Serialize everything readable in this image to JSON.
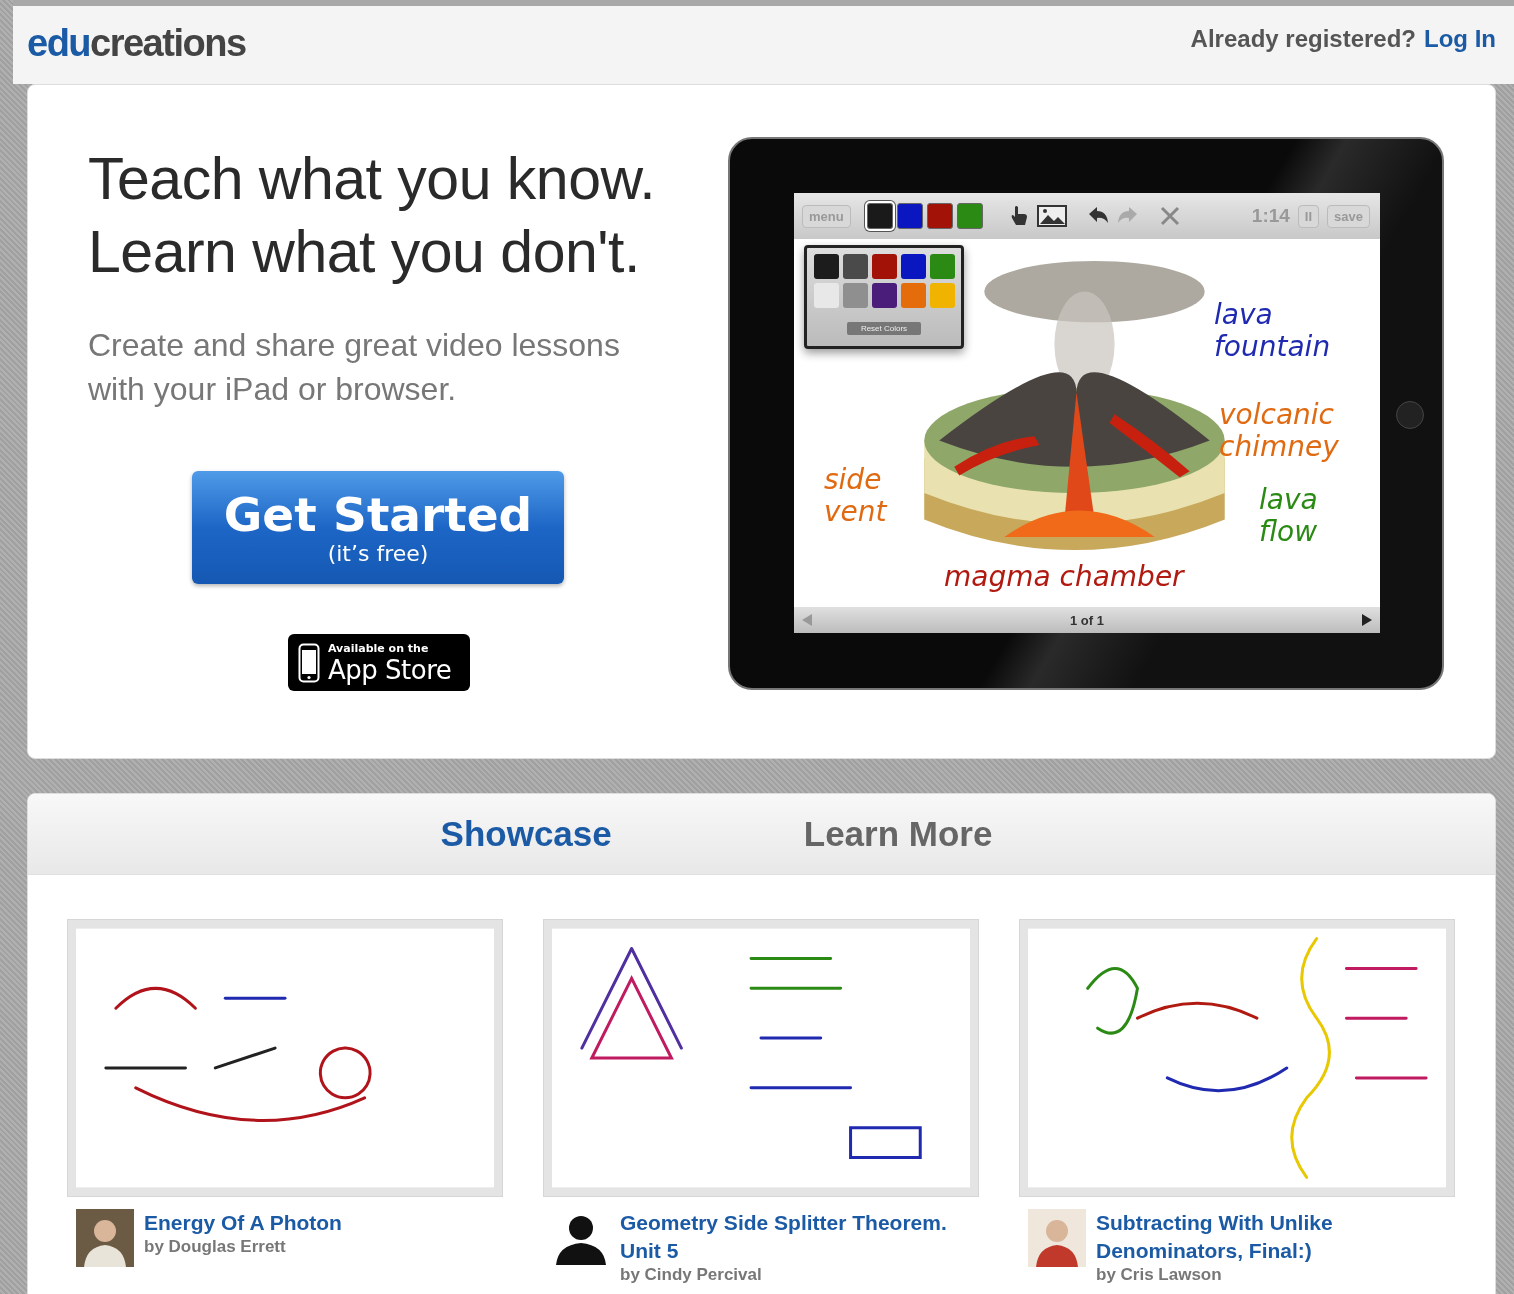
{
  "header": {
    "logo": {
      "part1": "edu",
      "part2": "creations"
    },
    "prompt": "Already registered?",
    "login_link": "Log In"
  },
  "hero": {
    "headline": [
      "Teach what you know.",
      "Learn what you don't."
    ],
    "subtitle": [
      "Create and share great video lessons",
      "with your iPad or browser."
    ],
    "cta": {
      "label": "Get Started",
      "note": "(it’s free)"
    },
    "app_store_badge": {
      "small": "Available on the",
      "large": "App Store"
    },
    "ipad": {
      "toolbar": {
        "menu": "menu",
        "timer": "1:14",
        "pause": "II",
        "save": "save",
        "swatches": [
          {
            "color": "#1a1a1a",
            "selected": true
          },
          {
            "color": "#0a17c0",
            "selected": false
          },
          {
            "color": "#a31206",
            "selected": false
          },
          {
            "color": "#2a8a14",
            "selected": false
          }
        ]
      },
      "palette": {
        "colors": [
          {
            "color": "#1c1c1c"
          },
          {
            "color": "#4a4a4a"
          },
          {
            "color": "#a31206"
          },
          {
            "color": "#0a17c0"
          },
          {
            "color": "#2a8a14"
          },
          {
            "color": "#e8e8e8"
          },
          {
            "color": "#8f8f8f"
          },
          {
            "color": "#4b1d7a"
          },
          {
            "color": "#e46c0a"
          },
          {
            "color": "#f0b400"
          }
        ],
        "reset": "Reset Colors"
      },
      "annotations": [
        {
          "lines": [
            "lava",
            "fountain"
          ],
          "color": "#1f2ab0"
        },
        {
          "lines": [
            "volcanic",
            "chimney"
          ],
          "color": "#e06a12"
        },
        {
          "lines": [
            "side",
            "vent"
          ],
          "color": "#e06a12"
        },
        {
          "lines": [
            "lava",
            "flow"
          ],
          "color": "#2a8a14"
        },
        {
          "lines": [
            "magma chamber"
          ],
          "color": "#b01a10"
        }
      ],
      "page_indicator": "1 of 1"
    }
  },
  "showcase": {
    "tabs": [
      {
        "label": "Showcase",
        "selected": true
      },
      {
        "label": "Learn More",
        "selected": false
      }
    ],
    "lessons": [
      {
        "title": "Energy Of A Photon",
        "author": "by Douglas Errett"
      },
      {
        "title": "Geometry Side Splitter Theorem. Unit 5",
        "author": "by Cindy Percival",
        "kind": "silhouette"
      },
      {
        "title": "Subtracting With Unlike Denominators, Final:)",
        "author": "by Cris Lawson"
      }
    ]
  }
}
